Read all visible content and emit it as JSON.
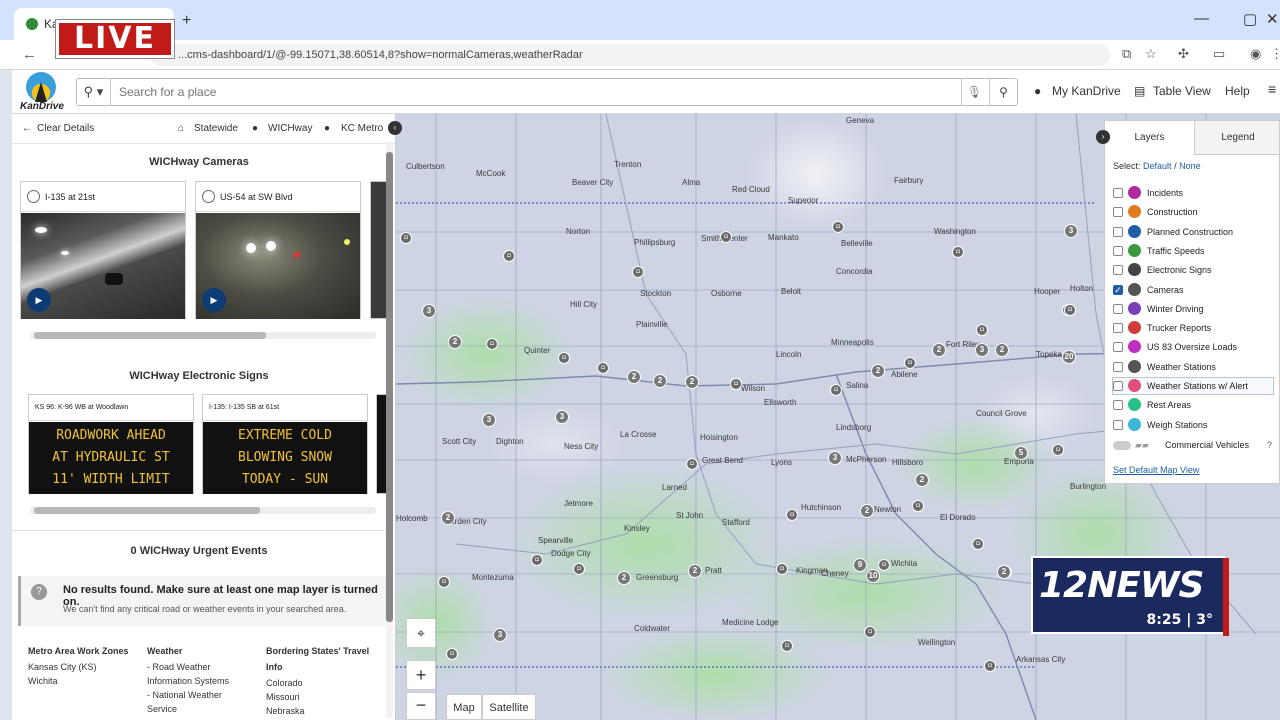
{
  "browser": {
    "tab_title": "Ka",
    "url": "...cms-dashboard/1/@-99.15071,38.60514,8?show=normalCameras,weatherRadar"
  },
  "overlay": {
    "live_label": "LIVE"
  },
  "header": {
    "logo_text": "KanDrive",
    "search_placeholder": "Search for a place",
    "my_kandrive": "My KanDrive",
    "table_view": "Table View",
    "help": "Help"
  },
  "panel": {
    "nav": {
      "clear": "Clear Details",
      "statewide": "Statewide",
      "wichway": "WICHway",
      "kcmetro": "KC Metro"
    },
    "cameras_title": "WICHway Cameras",
    "cameras": [
      {
        "label": "I-135 at 21st"
      },
      {
        "label": "US-54 at SW Blvd"
      }
    ],
    "signs_title": "WICHway Electronic Signs",
    "signs": [
      {
        "label": "KS 96: K-96 WB at Woodlawn",
        "lines": [
          "ROADWORK AHEAD",
          "AT HYDRAULIC ST",
          "11' WIDTH LIMIT"
        ]
      },
      {
        "label": "I-135: I-135 SB at 61st",
        "lines": [
          "EXTREME COLD",
          "BLOWING SNOW",
          "TODAY - SUN"
        ]
      }
    ],
    "events_title": "0 WICHway Urgent Events",
    "no_results_title": "No results found. Make sure at least one map layer is turned on.",
    "no_results_sub": "We can't find any critical road or weather events in your searched area.",
    "footer": {
      "col1_title": "Metro Area Work Zones",
      "col1_items": [
        "Kansas City (KS)",
        "Wichita"
      ],
      "col2_title": "Weather",
      "col2_items": [
        "- Road Weather",
        "Information Systems",
        "- National Weather",
        "Service"
      ],
      "col3_title": "Bordering States' Travel",
      "col3_title2": "Info",
      "col3_items": [
        "Colorado",
        "Missouri",
        "Nebraska"
      ]
    }
  },
  "map": {
    "cities": [
      "Geneva",
      "Culbertson",
      "Trenton",
      "McCook",
      "Beaver City",
      "Alma",
      "Red Cloud",
      "Superior",
      "Fairbury",
      "Norton",
      "Phillipsburg",
      "Smith Center",
      "Mankato",
      "Belleville",
      "Washington",
      "Concordia",
      "Stockton",
      "Osborne",
      "Beloit",
      "Hill City",
      "Plainville",
      "Minneapolis",
      "Quinter",
      "Lincoln",
      "Wilson",
      "Salina",
      "Abilene",
      "Fort Riley",
      "Topeka",
      "Ellsworth",
      "Council Grove",
      "Lindsborg",
      "Scott City",
      "Dighton",
      "Ness City",
      "La Crosse",
      "Hoisington",
      "Great Bend",
      "Lyons",
      "McPherson",
      "Hillsboro",
      "Emporia",
      "Burlington",
      "Larned",
      "Holcomb",
      "Garden City",
      "Jetmore",
      "St John",
      "Stafford",
      "Hutchinson",
      "Newton",
      "El Dorado",
      "Kinsley",
      "Spearville",
      "Dodge City",
      "Montezuma",
      "Greensburg",
      "Pratt",
      "Kingman",
      "Cheney",
      "Wichita",
      "Coldwater",
      "Medicine Lodge",
      "Wellington",
      "Arkansas City",
      "Hooper",
      "Holton"
    ],
    "controls": {
      "map": "Map",
      "satellite": "Satellite"
    }
  },
  "layers": {
    "tab_layers": "Layers",
    "tab_legend": "Legend",
    "select_label": "Select:",
    "select_default": "Default",
    "select_none": "None",
    "items": [
      {
        "label": "Incidents",
        "checked": false,
        "color": "#b02a9c"
      },
      {
        "label": "Construction",
        "checked": false,
        "color": "#e07b22"
      },
      {
        "label": "Planned Construction",
        "checked": false,
        "color": "#1f5fa8"
      },
      {
        "label": "Traffic Speeds",
        "checked": false,
        "color": "#3b9a3b"
      },
      {
        "label": "Electronic Signs",
        "checked": false,
        "color": "#444444"
      },
      {
        "label": "Cameras",
        "checked": true,
        "color": "#555555"
      },
      {
        "label": "Winter Driving",
        "checked": false,
        "color": "#7a3fb8"
      },
      {
        "label": "Trucker Reports",
        "checked": false,
        "color": "#d23b3b"
      },
      {
        "label": "US 83 Oversize Loads",
        "checked": false,
        "color": "#c02ec0"
      },
      {
        "label": "Weather Stations",
        "checked": false,
        "color": "#555555"
      },
      {
        "label": "Weather Stations w/ Alert",
        "checked": false,
        "color": "#e0507a"
      },
      {
        "label": "Rest Areas",
        "checked": false,
        "color": "#2bbf8a"
      },
      {
        "label": "Weigh Stations",
        "checked": false,
        "color": "#39b8d6"
      }
    ],
    "commercial": "Commercial Vehicles",
    "set_default": "Set Default Map View"
  },
  "news": {
    "brand": "12NEWS",
    "time": "8:25",
    "temp": "3°"
  }
}
